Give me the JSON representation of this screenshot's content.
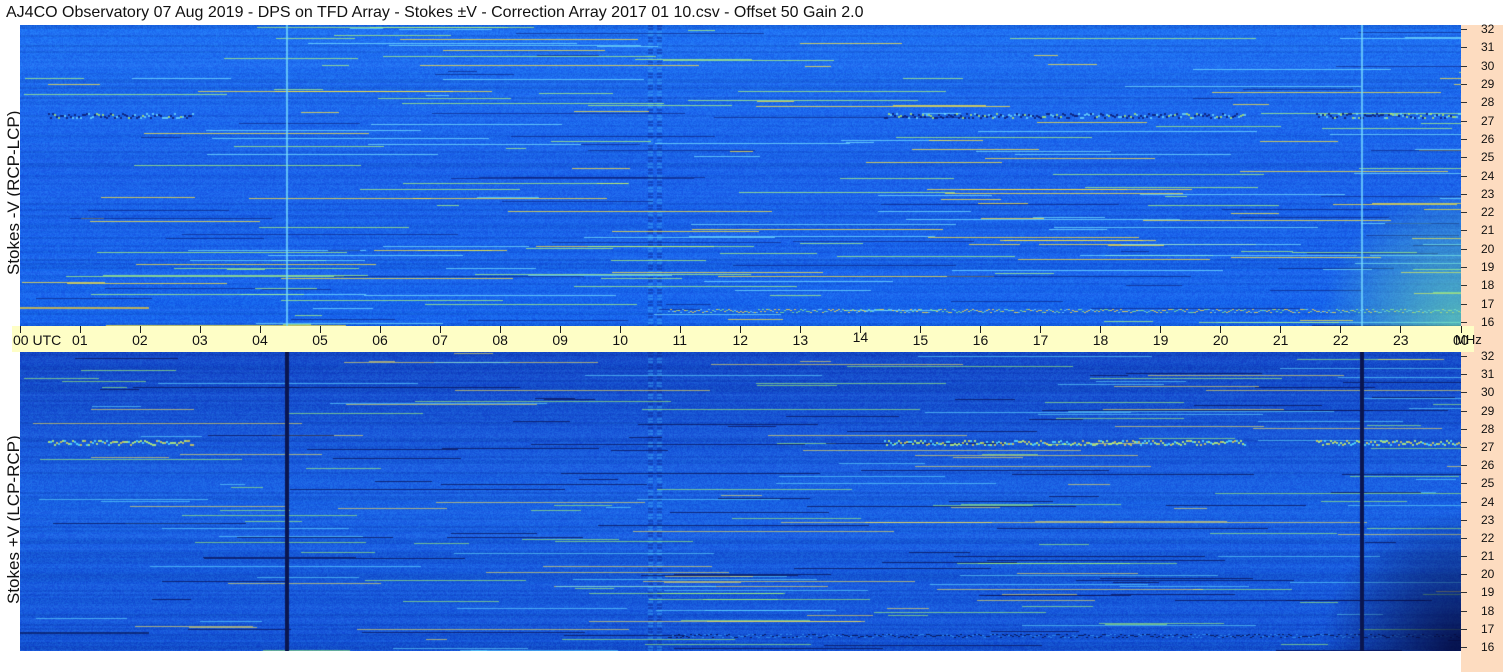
{
  "title": "AJ4CO Observatory  07 Aug 2019  -  DPS on TFD Array  -  Stokes ±V  -  Correction Array 2017 01 10.csv  -  Offset 50  Gain 2.0",
  "colors": {
    "background_strip": "#fddcc0",
    "time_bar": "#fefec6",
    "plot_base": "#1466ee"
  },
  "chart_data": [
    {
      "type": "heatmap",
      "ylabel": "Stokes -V  (RCP-LCP)",
      "ylim": [
        16,
        32
      ],
      "y_ticks": [
        "32",
        "31",
        "30",
        "29",
        "28",
        "27",
        "26",
        "25",
        "24",
        "23",
        "22",
        "21",
        "20",
        "19",
        "18",
        "17",
        "16"
      ]
    },
    {
      "type": "heatmap",
      "ylabel": "Stokes +V  (LCP-RCP)",
      "ylim": [
        16,
        32
      ],
      "y_ticks": [
        "32",
        "31",
        "30",
        "29",
        "28",
        "27",
        "26",
        "25",
        "24",
        "23",
        "22",
        "21",
        "20",
        "19",
        "18",
        "17",
        "16"
      ]
    }
  ],
  "time_axis": {
    "labels": [
      "00  UTC",
      "01",
      "02",
      "03",
      "04",
      "05",
      "06",
      "07",
      "08",
      "09",
      "10",
      "11",
      "12",
      "13",
      "14",
      "15",
      "16",
      "17",
      "18",
      "19",
      "20",
      "21",
      "22",
      "23",
      "00"
    ],
    "unit": "MHz"
  }
}
